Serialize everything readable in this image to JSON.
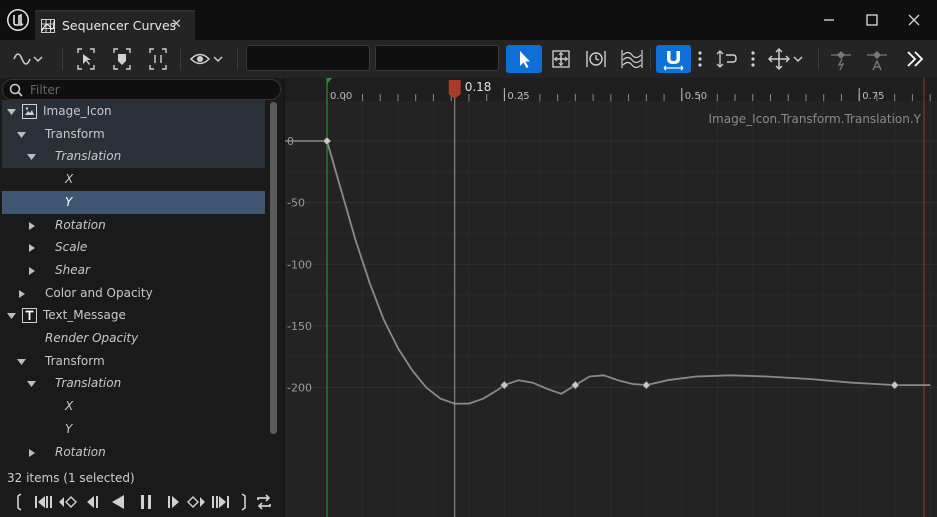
{
  "window": {
    "tab_title": "Sequencer Curves",
    "tab_close": "✕",
    "minimize": "minimize",
    "maximize": "maximize",
    "close": "close"
  },
  "toolbar": {
    "field_one_value": "",
    "field_two_value": ""
  },
  "filter": {
    "placeholder": "Filter"
  },
  "tree": [
    {
      "label": "Image_Icon",
      "indent": 0,
      "state": "expanded",
      "icon": "image-icon",
      "italic": false,
      "row": "hl"
    },
    {
      "label": "Transform",
      "indent": 1,
      "state": "expanded",
      "italic": false,
      "row": "hl"
    },
    {
      "label": "Translation",
      "indent": 2,
      "state": "expanded",
      "italic": true,
      "row": "hl"
    },
    {
      "label": "X",
      "indent": 3,
      "state": "leaf",
      "italic": true,
      "row": ""
    },
    {
      "label": "Y",
      "indent": 3,
      "state": "leaf",
      "italic": true,
      "row": "sel"
    },
    {
      "label": "Rotation",
      "indent": 2,
      "state": "collapsed",
      "italic": true,
      "row": ""
    },
    {
      "label": "Scale",
      "indent": 2,
      "state": "collapsed",
      "italic": true,
      "row": ""
    },
    {
      "label": "Shear",
      "indent": 2,
      "state": "collapsed",
      "italic": true,
      "row": ""
    },
    {
      "label": "Color and Opacity",
      "indent": 1,
      "state": "collapsed",
      "italic": false,
      "row": ""
    },
    {
      "label": "Text_Message",
      "indent": 0,
      "state": "expanded",
      "icon": "text-icon",
      "italic": false,
      "row": ""
    },
    {
      "label": "Render Opacity",
      "indent": 1,
      "state": "leaf",
      "italic": true,
      "row": ""
    },
    {
      "label": "Transform",
      "indent": 1,
      "state": "expanded",
      "italic": false,
      "row": ""
    },
    {
      "label": "Translation",
      "indent": 2,
      "state": "expanded",
      "italic": true,
      "row": ""
    },
    {
      "label": "X",
      "indent": 3,
      "state": "leaf",
      "italic": true,
      "row": ""
    },
    {
      "label": "Y",
      "indent": 3,
      "state": "leaf",
      "italic": true,
      "row": ""
    },
    {
      "label": "Rotation",
      "indent": 2,
      "state": "collapsed",
      "italic": true,
      "row": ""
    }
  ],
  "status": "32 items (1 selected)",
  "curve_editor": {
    "curve_label": "Image_Icon.Transform.Translation.Y",
    "playhead_label": "0.18",
    "playhead_time": 0.18,
    "time_ticks": [
      "0.00",
      "0.25",
      "0.50",
      "0.75"
    ],
    "value_ticks": [
      "0",
      "-50",
      "-100",
      "-150",
      "-200"
    ],
    "curve_color": "#8a8a8a",
    "playhead_color": "#a83a28",
    "start_marker_color": "#2c8f2c",
    "end_marker_color": "#8f2c2c"
  },
  "chart_data": {
    "type": "line",
    "title": "Image_Icon.Transform.Translation.Y",
    "xlim": [
      0,
      0.85
    ],
    "ylim": [
      -215,
      8
    ],
    "keys": [
      {
        "x": 0.0,
        "y": 0
      },
      {
        "x": 0.25,
        "y": -198
      },
      {
        "x": 0.35,
        "y": -198
      },
      {
        "x": 0.45,
        "y": -198
      },
      {
        "x": 0.8,
        "y": -198
      }
    ],
    "samples": [
      [
        0.0,
        0
      ],
      [
        0.02,
        -40
      ],
      [
        0.04,
        -80
      ],
      [
        0.06,
        -115
      ],
      [
        0.08,
        -145
      ],
      [
        0.1,
        -168
      ],
      [
        0.12,
        -186
      ],
      [
        0.14,
        -200
      ],
      [
        0.16,
        -209
      ],
      [
        0.18,
        -213
      ],
      [
        0.2,
        -213
      ],
      [
        0.22,
        -209
      ],
      [
        0.24,
        -202
      ],
      [
        0.25,
        -198
      ],
      [
        0.27,
        -194
      ],
      [
        0.29,
        -196
      ],
      [
        0.31,
        -201
      ],
      [
        0.33,
        -205
      ],
      [
        0.35,
        -198
      ],
      [
        0.37,
        -191
      ],
      [
        0.39,
        -190
      ],
      [
        0.41,
        -194
      ],
      [
        0.43,
        -197
      ],
      [
        0.45,
        -198
      ],
      [
        0.48,
        -194
      ],
      [
        0.52,
        -191
      ],
      [
        0.57,
        -190
      ],
      [
        0.62,
        -191
      ],
      [
        0.68,
        -193
      ],
      [
        0.74,
        -196
      ],
      [
        0.77,
        -197
      ],
      [
        0.8,
        -198
      ],
      [
        0.85,
        -198
      ]
    ],
    "grid": true
  }
}
